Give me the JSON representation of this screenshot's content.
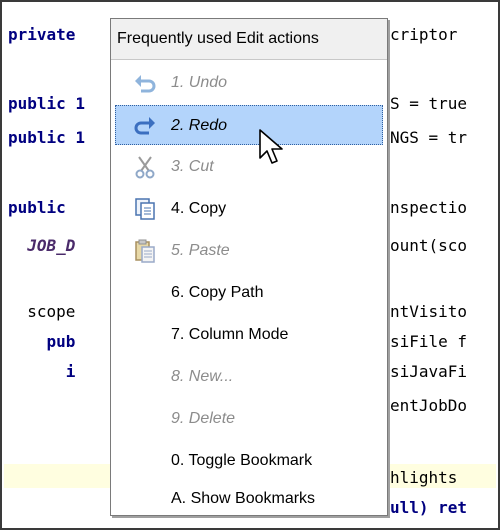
{
  "code": {
    "lines_left": [
      {
        "text": "private"
      },
      {
        "text": "public 1"
      },
      {
        "text": "public 1"
      },
      {
        "text": "public"
      },
      {
        "text": "  JOB_D"
      },
      {
        "text": "  scope"
      },
      {
        "text": "    pub"
      },
      {
        "text": "      i"
      }
    ],
    "lines_right": [
      {
        "text": "criptor"
      },
      {
        "text": "S = true"
      },
      {
        "text": "NGS = tr"
      },
      {
        "text": "nspectio"
      },
      {
        "text": "ount(sco"
      },
      {
        "text": "ntVisito"
      },
      {
        "text": "siFile f"
      },
      {
        "text": "siJavaFi"
      },
      {
        "text": "entJobDo"
      },
      {
        "text": "hlights "
      },
      {
        "text": "ull) ret"
      }
    ]
  },
  "popup": {
    "title": "Frequently used Edit actions",
    "items": [
      {
        "label": "1. Undo",
        "icon": "undo-icon",
        "enabled": false
      },
      {
        "label": "2. Redo",
        "icon": "redo-icon",
        "enabled": true,
        "selected": true
      },
      {
        "label": "3. Cut",
        "icon": "cut-icon",
        "enabled": false
      },
      {
        "label": "4. Copy",
        "icon": "copy-icon",
        "enabled": true
      },
      {
        "label": "5. Paste",
        "icon": "paste-icon",
        "enabled": false
      },
      {
        "label": "6. Copy Path",
        "enabled": true
      },
      {
        "label": "7. Column Mode",
        "enabled": true
      },
      {
        "label": "8. New...",
        "enabled": false
      },
      {
        "label": "9. Delete",
        "enabled": false
      },
      {
        "label": "0. Toggle Bookmark",
        "enabled": true
      },
      {
        "label": "A. Show Bookmarks",
        "enabled": true
      }
    ]
  },
  "colors": {
    "selection": "#b3d4fb",
    "disabled_text": "#8c8c8c",
    "keyword": "#000080",
    "highlight_line": "#fffee0"
  }
}
